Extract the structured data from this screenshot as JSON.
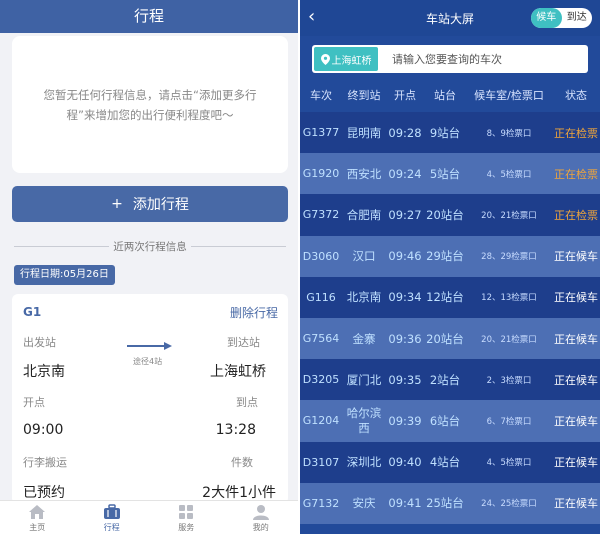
{
  "left": {
    "header_title": "行程",
    "empty_message": "您暂无任何行程信息，请点击“添加更多行程”来增加您的出行便利程度吧〜",
    "add_button": "添加行程",
    "add_icon": "+",
    "divider_text": "近两次行程信息",
    "trip_date": "行程日期:05月26日",
    "trip": {
      "train_no": "G1",
      "delete_label": "删除行程",
      "depart_label": "出发站",
      "arrive_label": "到达站",
      "depart_station": "北京南",
      "arrive_station": "上海虹桥",
      "via": "途径4站",
      "depart_time_label": "开点",
      "arrive_time_label": "到点",
      "depart_time": "09:00",
      "arrive_time": "13:28",
      "luggage_label": "行李搬运",
      "pieces_label": "件数",
      "luggage_value": "已预约",
      "pieces_value": "2大件1小件"
    },
    "tabs": [
      {
        "label": "主页",
        "icon": "home-icon"
      },
      {
        "label": "行程",
        "icon": "briefcase-icon"
      },
      {
        "label": "服务",
        "icon": "grid-icon"
      },
      {
        "label": "我的",
        "icon": "user-icon"
      }
    ]
  },
  "right": {
    "back_icon": "‹",
    "title": "车站大屏",
    "toggle": {
      "active": "候车",
      "inactive": "到达"
    },
    "station_label": "上海虹桥",
    "search_placeholder": "请输入您要查询的车次",
    "headers": [
      "车次",
      "终到站",
      "开点",
      "站台",
      "候车室/检票口",
      "状态"
    ],
    "colors": {
      "checking": "#f0a53a",
      "waiting": "#ffffff",
      "accent": "#3fc0c2"
    },
    "rows": [
      {
        "train": "G1377",
        "dest": "昆明南",
        "time": "09:28",
        "platform": "9站台",
        "gate": "8、9检票口",
        "status": "正在检票"
      },
      {
        "train": "G1920",
        "dest": "西安北",
        "time": "09:24",
        "platform": "5站台",
        "gate": "4、5检票口",
        "status": "正在检票"
      },
      {
        "train": "G7372",
        "dest": "合肥南",
        "time": "09:27",
        "platform": "20站台",
        "gate": "20、21检票口",
        "status": "正在检票"
      },
      {
        "train": "D3060",
        "dest": "汉口",
        "time": "09:46",
        "platform": "29站台",
        "gate": "28、29检票口",
        "status": "正在候车"
      },
      {
        "train": "G116",
        "dest": "北京南",
        "time": "09:34",
        "platform": "12站台",
        "gate": "12、13检票口",
        "status": "正在候车"
      },
      {
        "train": "G7564",
        "dest": "金寨",
        "time": "09:36",
        "platform": "20站台",
        "gate": "20、21检票口",
        "status": "正在候车"
      },
      {
        "train": "D3205",
        "dest": "厦门北",
        "time": "09:35",
        "platform": "2站台",
        "gate": "2、3检票口",
        "status": "正在候车"
      },
      {
        "train": "G1204",
        "dest": "哈尔滨西",
        "time": "09:39",
        "platform": "6站台",
        "gate": "6、7检票口",
        "status": "正在候车"
      },
      {
        "train": "D3107",
        "dest": "深圳北",
        "time": "09:40",
        "platform": "4站台",
        "gate": "4、5检票口",
        "status": "正在候车"
      },
      {
        "train": "G7132",
        "dest": "安庆",
        "time": "09:41",
        "platform": "25站台",
        "gate": "24、25检票口",
        "status": "正在候车"
      }
    ]
  }
}
